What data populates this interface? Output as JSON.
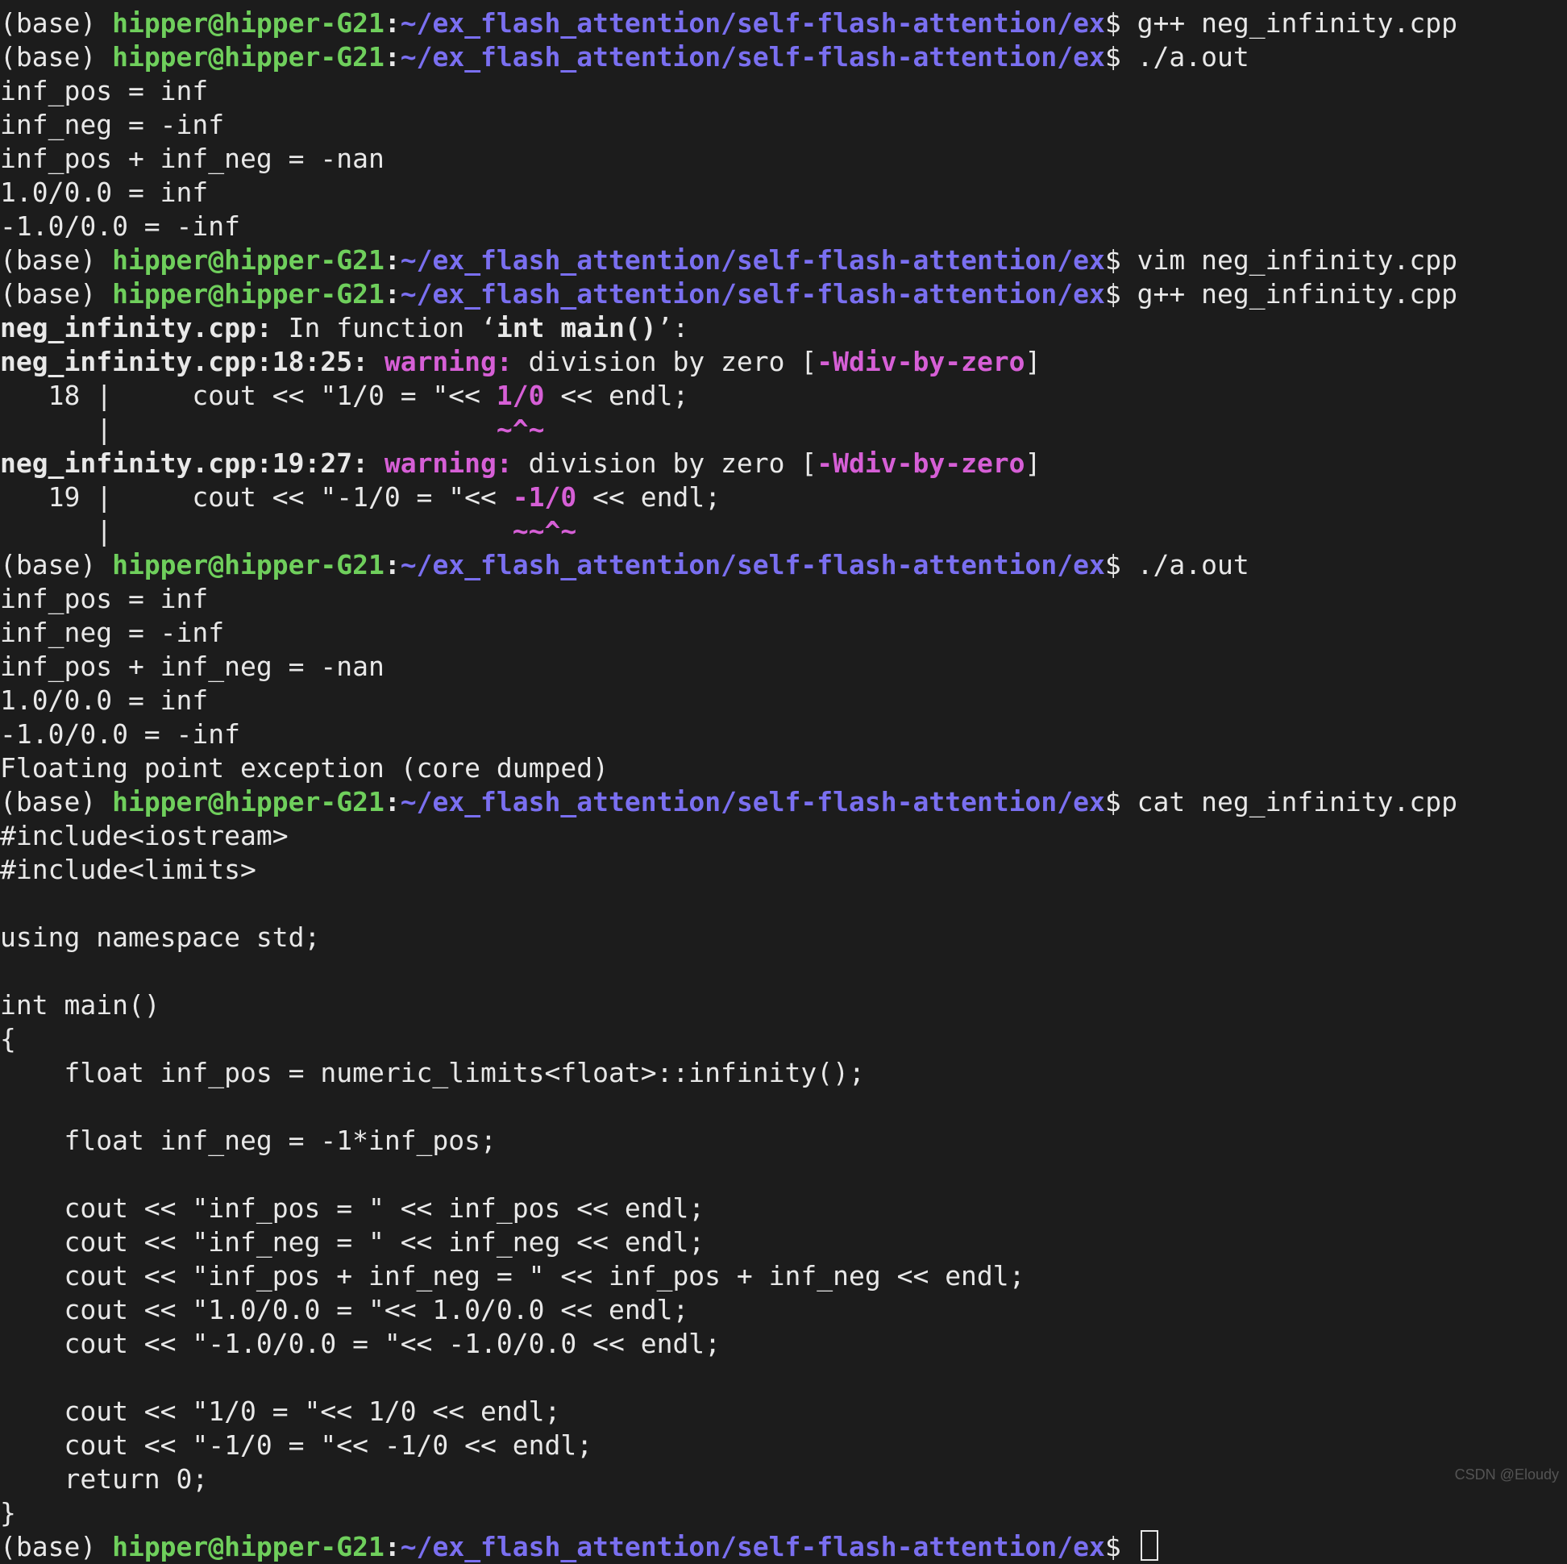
{
  "prompt": {
    "base": "(base) ",
    "user": "hipper@hipper-G21",
    "colon": ":",
    "path": "~/ex_flash_attention/self-flash-attention/ex",
    "dollar": "$ "
  },
  "cmds": {
    "gpp": "g++ neg_infinity.cpp",
    "aout": "./a.out",
    "vim": "vim neg_infinity.cpp",
    "cat": "cat neg_infinity.cpp"
  },
  "run1": {
    "l1": "inf_pos = inf",
    "l2": "inf_neg = -inf",
    "l3": "inf_pos + inf_neg = -nan",
    "l4": "1.0/0.0 = inf",
    "l5": "-1.0/0.0 = -inf"
  },
  "warn": {
    "file_func_a": "neg_infinity.cpp:",
    "file_func_b": " In function ‘",
    "file_func_c": "int main()",
    "file_func_d": "’:",
    "loc18": "neg_infinity.cpp:18:25: ",
    "loc19": "neg_infinity.cpp:19:27: ",
    "label": "warning: ",
    "msg_a": "division by zero [",
    "flag": "-Wdiv-by-zero",
    "msg_b": "]",
    "ln18_a": "   18 |     cout << \"1/0 = \"<< ",
    "ln18_b": "1/0",
    "ln18_c": " << endl;",
    "caret18_a": "      |                        ",
    "caret18_b": "~^~",
    "ln19_a": "   19 |     cout << \"-1/0 = \"<< ",
    "ln19_b": "-1/0",
    "ln19_c": " << endl;",
    "caret19_a": "      |                         ",
    "caret19_b": "~~^~"
  },
  "run2": {
    "l1": "inf_pos = inf",
    "l2": "inf_neg = -inf",
    "l3": "inf_pos + inf_neg = -nan",
    "l4": "1.0/0.0 = inf",
    "l5": "-1.0/0.0 = -inf",
    "l6": "Floating point exception (core dumped)"
  },
  "src": {
    "l1": "#include<iostream>",
    "l2": "#include<limits>",
    "l3": "",
    "l4": "using namespace std;",
    "l5": "",
    "l6": "int main()",
    "l7": "{",
    "l8": "    float inf_pos = numeric_limits<float>::infinity();",
    "l9": "",
    "l10": "    float inf_neg = -1*inf_pos;",
    "l11": "",
    "l12": "    cout << \"inf_pos = \" << inf_pos << endl;",
    "l13": "    cout << \"inf_neg = \" << inf_neg << endl;",
    "l14": "    cout << \"inf_pos + inf_neg = \" << inf_pos + inf_neg << endl;",
    "l15": "    cout << \"1.0/0.0 = \"<< 1.0/0.0 << endl;",
    "l16": "    cout << \"-1.0/0.0 = \"<< -1.0/0.0 << endl;",
    "l17": "",
    "l18": "    cout << \"1/0 = \"<< 1/0 << endl;",
    "l19": "    cout << \"-1/0 = \"<< -1/0 << endl;",
    "l20": "    return 0;",
    "l21": "}"
  },
  "watermark": "CSDN @Eloudy"
}
